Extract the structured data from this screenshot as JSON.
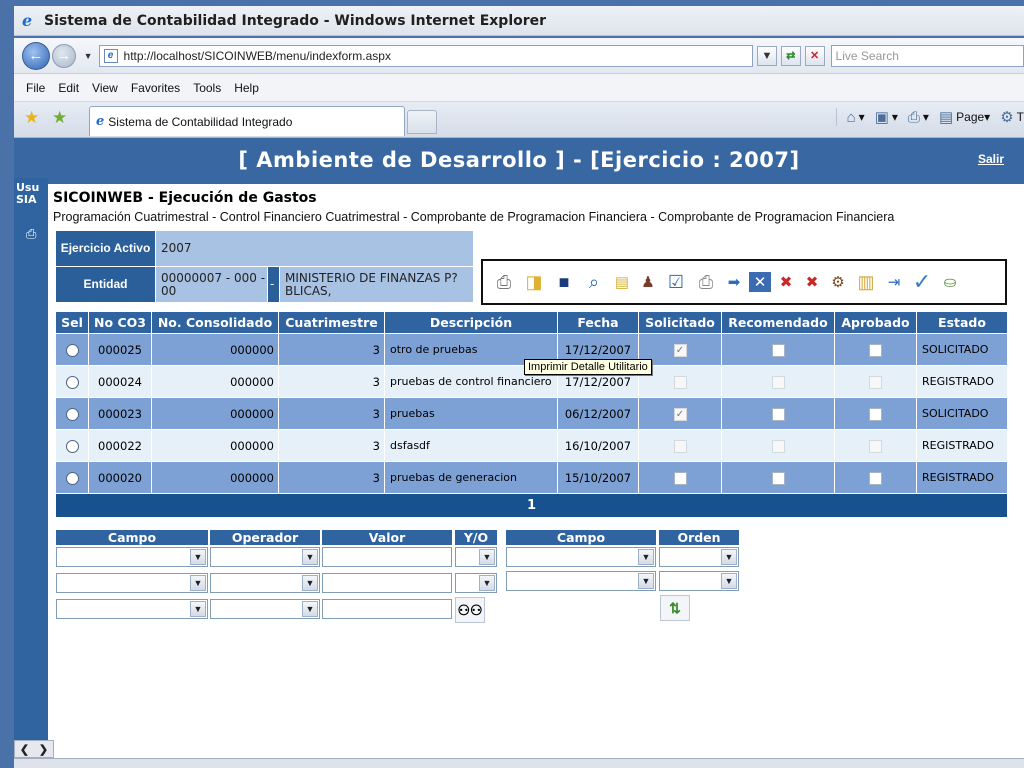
{
  "browser": {
    "window_title": "Sistema de Contabilidad Integrado - Windows Internet Explorer",
    "url": "http://localhost/SICOINWEB/menu/indexform.aspx",
    "search_placeholder": "Live Search",
    "menu": [
      "File",
      "Edit",
      "View",
      "Favorites",
      "Tools",
      "Help"
    ],
    "tab_title": "Sistema de Contabilidad Integrado",
    "page_label": "Page",
    "tools_label": "T"
  },
  "header": {
    "title": "[ Ambiente de Desarrollo ] - [Ejercicio : 2007]",
    "logout": "Salir"
  },
  "left_strip": {
    "label_line1": "Usu",
    "label_line2": "SIA"
  },
  "page": {
    "heading": "SICOINWEB - Ejecución de Gastos",
    "breadcrumb": "Programación Cuatrimestral - Control Financiero Cuatrimestral - Comprobante de Programacion Financiera - Comprobante de Programacion Financiera"
  },
  "info": {
    "ejercicio_label": "Ejercicio Activo",
    "ejercicio_value": "2007",
    "entidad_label": "Entidad",
    "entidad_code": "00000007 - 000 - 00",
    "entidad_sep": "-",
    "entidad_name": "MINISTERIO DE FINANZAS P?BLICAS,"
  },
  "toolbar": {
    "icons": [
      "print-icon",
      "open-folder-icon",
      "save-icon",
      "search-icon",
      "document-icon",
      "user-edit-icon",
      "checklist-icon",
      "print-detail-icon",
      "forward-icon",
      "cancel-icon",
      "delete-row-icon",
      "delete-all-icon",
      "settings-icon",
      "report-icon",
      "export-icon",
      "approve-icon",
      "database-icon"
    ]
  },
  "tooltip": "Imprimir Detalle Utilitario",
  "grid": {
    "columns": [
      "Sel",
      "No CO3",
      "No. Consolidado",
      "Cuatrimestre",
      "Descripción",
      "Fecha",
      "Solicitado",
      "Recomendado",
      "Aprobado",
      "Estado"
    ],
    "rows": [
      {
        "no": "000025",
        "consolidado": "000000",
        "cuatrimestre": "3",
        "descripcion": "otro de pruebas",
        "fecha": "17/12/2007",
        "solicitado": true,
        "estado": "SOLICITADO"
      },
      {
        "no": "000024",
        "consolidado": "000000",
        "cuatrimestre": "3",
        "descripcion": "pruebas de control financiero",
        "fecha": "17/12/2007",
        "solicitado": false,
        "estado": "REGISTRADO"
      },
      {
        "no": "000023",
        "consolidado": "000000",
        "cuatrimestre": "3",
        "descripcion": "pruebas",
        "fecha": "06/12/2007",
        "solicitado": true,
        "estado": "SOLICITADO"
      },
      {
        "no": "000022",
        "consolidado": "000000",
        "cuatrimestre": "3",
        "descripcion": "dsfasdf",
        "fecha": "16/10/2007",
        "solicitado": false,
        "estado": "REGISTRADO"
      },
      {
        "no": "000020",
        "consolidado": "000000",
        "cuatrimestre": "3",
        "descripcion": "pruebas de generacion",
        "fecha": "15/10/2007",
        "solicitado": false,
        "estado": "REGISTRADO"
      }
    ],
    "pager": "1"
  },
  "filters": {
    "campo": "Campo",
    "operador": "Operador",
    "valor": "Valor",
    "yo": "Y/O",
    "campo2": "Campo",
    "orden": "Orden"
  }
}
